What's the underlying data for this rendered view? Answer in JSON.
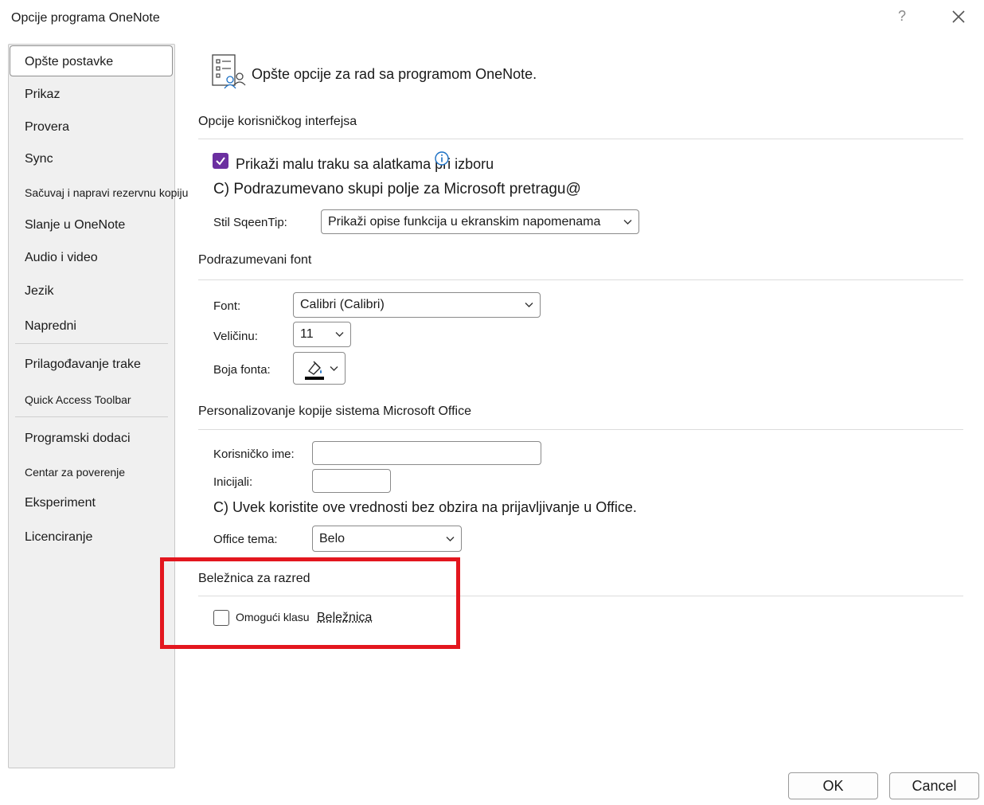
{
  "window": {
    "title": "Opcije programa OneNote",
    "help_glyph": "?"
  },
  "sidebar": {
    "items": [
      {
        "label": "Opšte postavke"
      },
      {
        "label": "Prikaz"
      },
      {
        "label": "Provera"
      },
      {
        "label": "Sync"
      },
      {
        "label": "Sačuvaj i napravi rezervnu kopiju"
      },
      {
        "label": "Slanje u OneNote"
      },
      {
        "label": "Audio i video"
      },
      {
        "label": "Jezik"
      },
      {
        "label": "Napredni"
      },
      {
        "label": "Prilagođavanje trake"
      },
      {
        "label": "Quick Access Toolbar"
      },
      {
        "label": "Programski dodaci"
      },
      {
        "label": "Centar za poverenje"
      },
      {
        "label": "Eksperiment"
      },
      {
        "label": "Licenciranje"
      }
    ]
  },
  "main": {
    "header": "Opšte opcije za rad sa programom OneNote.",
    "ui_section": {
      "title": "Opcije korisničkog interfejsa",
      "show_mini_toolbar": "Prikaži malu traku sa alatkama pri izboru",
      "collapse_search": "C) Podrazumevano skupi polje za Microsoft pretragu@",
      "screentip_label": "Stil SqeenTip:",
      "screentip_value": "Prikaži opise funkcija u ekranskim napomenama"
    },
    "font_section": {
      "title": "Podrazumevani font",
      "font_label": "Font:",
      "font_value": "Calibri (Calibri)",
      "size_label": "Veličinu:",
      "size_value": "11",
      "color_label": "Boja fonta:"
    },
    "office_section": {
      "title": "Personalizovanje kopije sistema Microsoft Office",
      "username_label": "Korisničko ime:",
      "username_value": "",
      "initials_label": "Inicijali:",
      "initials_value": "",
      "always_use": "C) Uvek koristite ove vrednosti bez obzira na prijavljivanje u Office.",
      "theme_label": "Office tema:",
      "theme_value": "Belo"
    },
    "class_section": {
      "title": "Beležnica za razred",
      "enable_label": "Omogući klasu",
      "enable_link": "Beležnica"
    }
  },
  "footer": {
    "ok": "OK",
    "cancel": "Cancel"
  },
  "colors": {
    "accent": "#6b2fa0",
    "highlight": "#e3161e"
  }
}
